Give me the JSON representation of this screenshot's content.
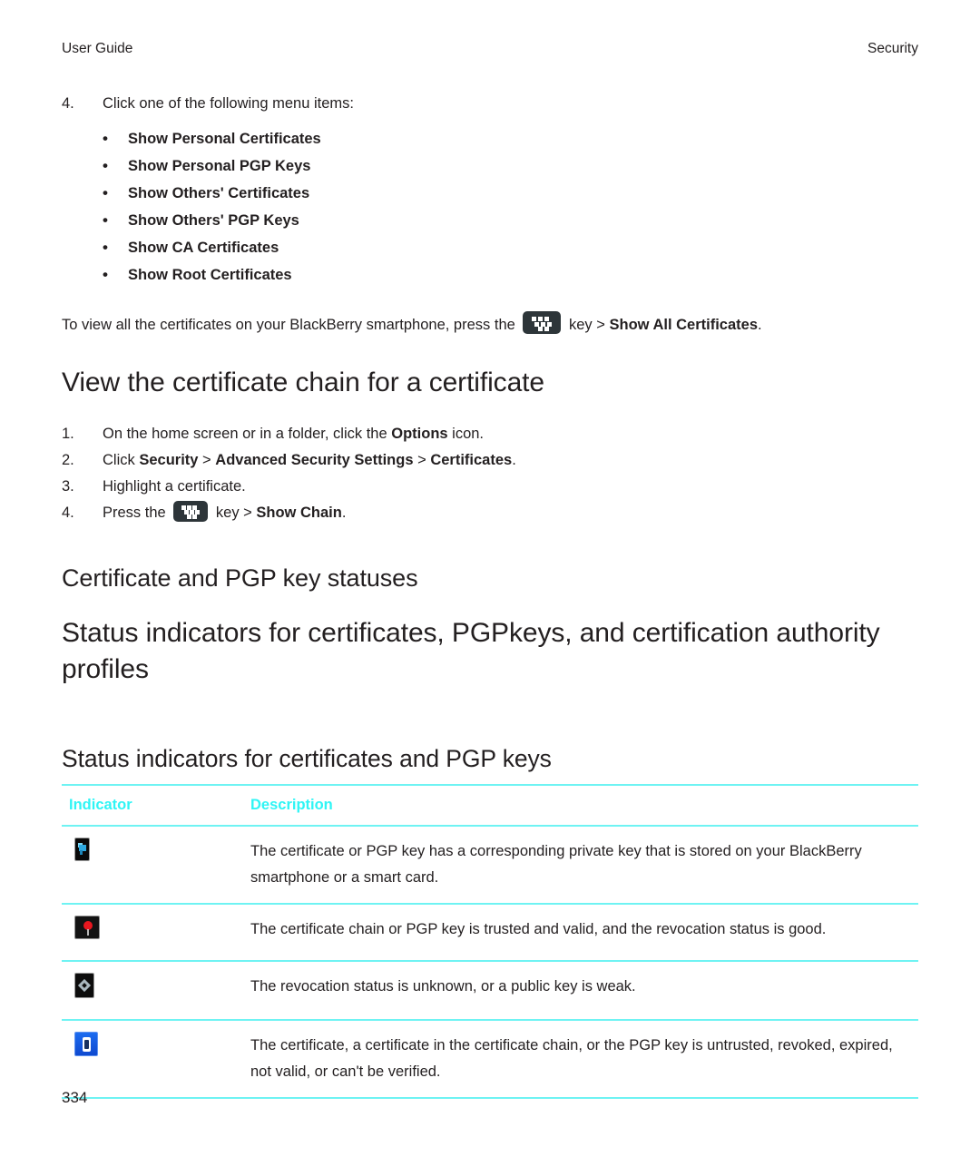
{
  "running_head": {
    "left": "User Guide",
    "right": "Security"
  },
  "section_show_items": {
    "step_number": "4.",
    "step_text": "Click one of the following menu items:",
    "bullet_glyph": "•",
    "items": [
      "Show Personal Certificates",
      "Show Personal PGP Keys",
      "Show Others' Certificates",
      "Show Others' PGP Keys",
      "Show CA Certificates",
      "Show Root Certificates"
    ],
    "note": {
      "before_icon": "To view all the certificates on your BlackBerry smartphone, press the",
      "icon_name": "blackberry-menu-key",
      "after_icon": "key >",
      "bold_tail": "Show All Certificates",
      "period": "."
    }
  },
  "section_view_chain": {
    "heading": "View the certificate chain for a certificate",
    "steps": [
      {
        "number": "1.",
        "plain_before": "On the home screen or in a folder, click the ",
        "bold": "Options",
        "plain_after": " icon."
      },
      {
        "number": "2.",
        "plain_before": "Click ",
        "bold": "Security",
        "sep1": " > ",
        "bold2": "Advanced Security Settings",
        "sep2": " > ",
        "bold3": "Certificates",
        "plain_after": "."
      },
      {
        "number": "3.",
        "plain_before": "Highlight a certificate.",
        "bold": "",
        "plain_after": ""
      },
      {
        "number": "4.",
        "plain_before": "Press the",
        "icon_name": "blackberry-menu-key",
        "after_icon": "key >",
        "bold": "Show Chain",
        "plain_after": "."
      }
    ]
  },
  "section_statuses": {
    "heading": "Certificate and PGP key statuses",
    "subheading": "Status indicators for certificates, PGPkeys, and certification authority profiles"
  },
  "table_section": {
    "heading": "Status indicators for certificates and PGP keys",
    "columns": [
      "Indicator",
      "Description"
    ],
    "rows": [
      {
        "icon_name": "private-key-indicator-icon",
        "description": "The certificate or PGP key has a corresponding private key that is stored on your BlackBerry smartphone or a smart card."
      },
      {
        "icon_name": "trusted-valid-indicator-icon",
        "description": "The certificate chain or PGP key is trusted and valid, and the revocation status is good."
      },
      {
        "icon_name": "unknown-status-indicator-icon",
        "description": "The revocation status is unknown, or a public key is weak."
      },
      {
        "icon_name": "untrusted-revoked-indicator-icon",
        "description": "The certificate, a certificate in the certificate chain, or the PGP key is untrusted, revoked, expired, not valid, or can't be verified."
      }
    ]
  },
  "folio": "334",
  "colors": {
    "accent_rule": "#6FF3F3",
    "header_text": "#2FF5F5",
    "body_text": "#231F20",
    "key_icon_bg": "#2D3539"
  }
}
